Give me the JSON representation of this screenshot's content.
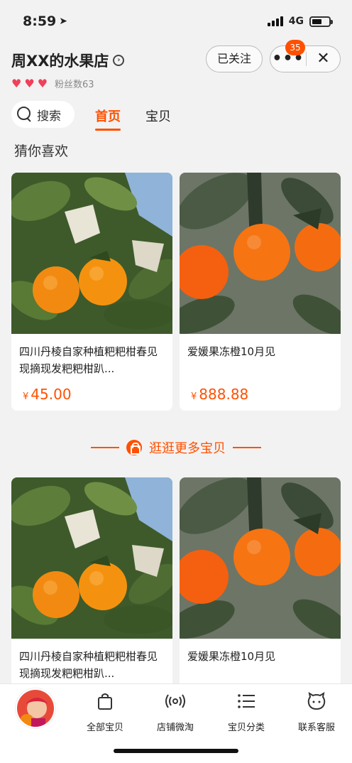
{
  "status_bar": {
    "time": "8:59",
    "network": "4G"
  },
  "shop": {
    "name": "周XX的水果店",
    "fans_label": "粉丝数63",
    "hearts": 3,
    "follow_label": "已关注",
    "more_label": "•••",
    "close_label": "✕",
    "notification_count": "35"
  },
  "nav": {
    "search_label": "搜索",
    "tabs": [
      {
        "label": "首页",
        "active": true
      },
      {
        "label": "宝贝",
        "active": false
      }
    ]
  },
  "section_title": "猜你喜欢",
  "products": [
    {
      "title": "四川丹棱自家种植粑粑柑春见现摘现发粑粑柑趴...",
      "currency": "¥",
      "price": "45.00",
      "image": "tangerine-tree"
    },
    {
      "title": "爱媛果冻橙10月见",
      "currency": "¥",
      "price": "888.88",
      "image": "orange-branch"
    }
  ],
  "more_link": "逛逛更多宝贝",
  "products_more": [
    {
      "title": "四川丹棱自家种植粑粑柑春见现摘现发粑粑柑趴...",
      "image": "tangerine-tree"
    },
    {
      "title": "爱媛果冻橙10月见",
      "image": "orange-branch"
    }
  ],
  "bottom_bar": {
    "items": [
      {
        "label": "全部宝贝",
        "icon": "shopping-bag-icon"
      },
      {
        "label": "店铺微淘",
        "icon": "broadcast-icon"
      },
      {
        "label": "宝贝分类",
        "icon": "category-list-icon"
      },
      {
        "label": "联系客服",
        "icon": "chat-face-icon"
      }
    ]
  },
  "colors": {
    "accent": "#ff5000",
    "heart": "#f0405a",
    "background": "#f2f2f2"
  }
}
